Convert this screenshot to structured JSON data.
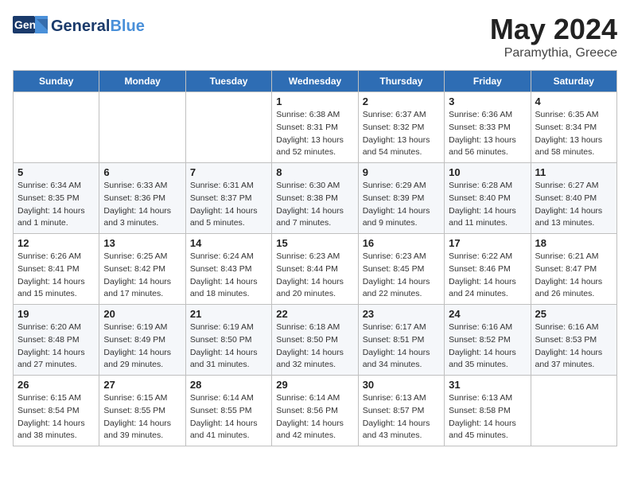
{
  "logo": {
    "general": "General",
    "blue": "Blue",
    "icon": "▶"
  },
  "title": "May 2024",
  "subtitle": "Paramythia, Greece",
  "headers": [
    "Sunday",
    "Monday",
    "Tuesday",
    "Wednesday",
    "Thursday",
    "Friday",
    "Saturday"
  ],
  "weeks": [
    [
      {
        "date": "",
        "info": ""
      },
      {
        "date": "",
        "info": ""
      },
      {
        "date": "",
        "info": ""
      },
      {
        "date": "1",
        "info": "Sunrise: 6:38 AM\nSunset: 8:31 PM\nDaylight: 13 hours\nand 52 minutes."
      },
      {
        "date": "2",
        "info": "Sunrise: 6:37 AM\nSunset: 8:32 PM\nDaylight: 13 hours\nand 54 minutes."
      },
      {
        "date": "3",
        "info": "Sunrise: 6:36 AM\nSunset: 8:33 PM\nDaylight: 13 hours\nand 56 minutes."
      },
      {
        "date": "4",
        "info": "Sunrise: 6:35 AM\nSunset: 8:34 PM\nDaylight: 13 hours\nand 58 minutes."
      }
    ],
    [
      {
        "date": "5",
        "info": "Sunrise: 6:34 AM\nSunset: 8:35 PM\nDaylight: 14 hours\nand 1 minute."
      },
      {
        "date": "6",
        "info": "Sunrise: 6:33 AM\nSunset: 8:36 PM\nDaylight: 14 hours\nand 3 minutes."
      },
      {
        "date": "7",
        "info": "Sunrise: 6:31 AM\nSunset: 8:37 PM\nDaylight: 14 hours\nand 5 minutes."
      },
      {
        "date": "8",
        "info": "Sunrise: 6:30 AM\nSunset: 8:38 PM\nDaylight: 14 hours\nand 7 minutes."
      },
      {
        "date": "9",
        "info": "Sunrise: 6:29 AM\nSunset: 8:39 PM\nDaylight: 14 hours\nand 9 minutes."
      },
      {
        "date": "10",
        "info": "Sunrise: 6:28 AM\nSunset: 8:40 PM\nDaylight: 14 hours\nand 11 minutes."
      },
      {
        "date": "11",
        "info": "Sunrise: 6:27 AM\nSunset: 8:40 PM\nDaylight: 14 hours\nand 13 minutes."
      }
    ],
    [
      {
        "date": "12",
        "info": "Sunrise: 6:26 AM\nSunset: 8:41 PM\nDaylight: 14 hours\nand 15 minutes."
      },
      {
        "date": "13",
        "info": "Sunrise: 6:25 AM\nSunset: 8:42 PM\nDaylight: 14 hours\nand 17 minutes."
      },
      {
        "date": "14",
        "info": "Sunrise: 6:24 AM\nSunset: 8:43 PM\nDaylight: 14 hours\nand 18 minutes."
      },
      {
        "date": "15",
        "info": "Sunrise: 6:23 AM\nSunset: 8:44 PM\nDaylight: 14 hours\nand 20 minutes."
      },
      {
        "date": "16",
        "info": "Sunrise: 6:23 AM\nSunset: 8:45 PM\nDaylight: 14 hours\nand 22 minutes."
      },
      {
        "date": "17",
        "info": "Sunrise: 6:22 AM\nSunset: 8:46 PM\nDaylight: 14 hours\nand 24 minutes."
      },
      {
        "date": "18",
        "info": "Sunrise: 6:21 AM\nSunset: 8:47 PM\nDaylight: 14 hours\nand 26 minutes."
      }
    ],
    [
      {
        "date": "19",
        "info": "Sunrise: 6:20 AM\nSunset: 8:48 PM\nDaylight: 14 hours\nand 27 minutes."
      },
      {
        "date": "20",
        "info": "Sunrise: 6:19 AM\nSunset: 8:49 PM\nDaylight: 14 hours\nand 29 minutes."
      },
      {
        "date": "21",
        "info": "Sunrise: 6:19 AM\nSunset: 8:50 PM\nDaylight: 14 hours\nand 31 minutes."
      },
      {
        "date": "22",
        "info": "Sunrise: 6:18 AM\nSunset: 8:50 PM\nDaylight: 14 hours\nand 32 minutes."
      },
      {
        "date": "23",
        "info": "Sunrise: 6:17 AM\nSunset: 8:51 PM\nDaylight: 14 hours\nand 34 minutes."
      },
      {
        "date": "24",
        "info": "Sunrise: 6:16 AM\nSunset: 8:52 PM\nDaylight: 14 hours\nand 35 minutes."
      },
      {
        "date": "25",
        "info": "Sunrise: 6:16 AM\nSunset: 8:53 PM\nDaylight: 14 hours\nand 37 minutes."
      }
    ],
    [
      {
        "date": "26",
        "info": "Sunrise: 6:15 AM\nSunset: 8:54 PM\nDaylight: 14 hours\nand 38 minutes."
      },
      {
        "date": "27",
        "info": "Sunrise: 6:15 AM\nSunset: 8:55 PM\nDaylight: 14 hours\nand 39 minutes."
      },
      {
        "date": "28",
        "info": "Sunrise: 6:14 AM\nSunset: 8:55 PM\nDaylight: 14 hours\nand 41 minutes."
      },
      {
        "date": "29",
        "info": "Sunrise: 6:14 AM\nSunset: 8:56 PM\nDaylight: 14 hours\nand 42 minutes."
      },
      {
        "date": "30",
        "info": "Sunrise: 6:13 AM\nSunset: 8:57 PM\nDaylight: 14 hours\nand 43 minutes."
      },
      {
        "date": "31",
        "info": "Sunrise: 6:13 AM\nSunset: 8:58 PM\nDaylight: 14 hours\nand 45 minutes."
      },
      {
        "date": "",
        "info": ""
      }
    ]
  ]
}
